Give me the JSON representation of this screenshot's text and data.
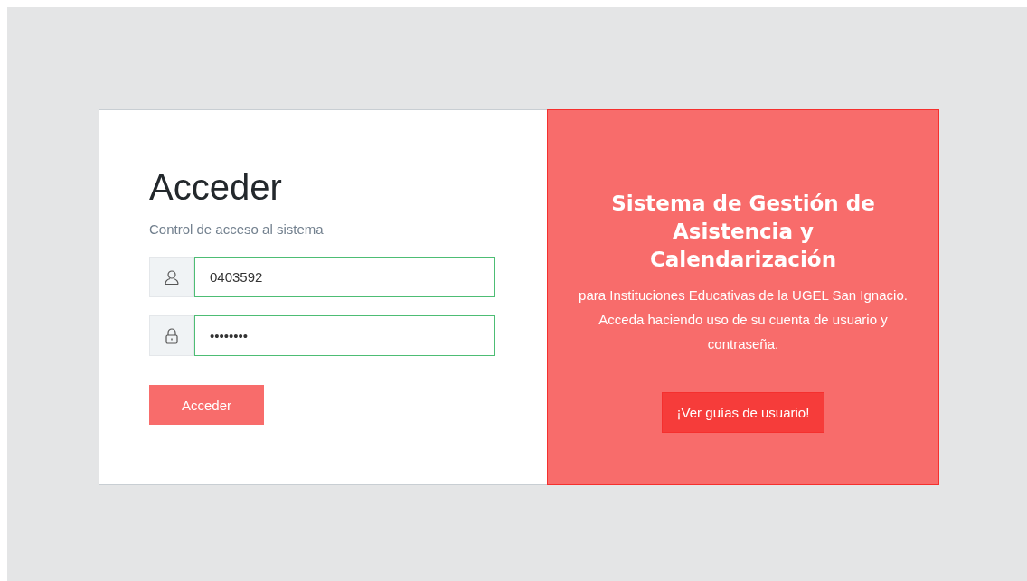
{
  "login": {
    "title": "Acceder",
    "subtitle": "Control de acceso al sistema",
    "fields": [
      {
        "kind": "user",
        "value": "0403592",
        "valid": true
      },
      {
        "kind": "password",
        "value": "••••••••",
        "valid": true
      }
    ],
    "button": "Acceder"
  },
  "info": {
    "title": "Sistema de Gestión de Asistencia y Calendarización",
    "text": "para Instituciones Educativas de la UGEL San Ignacio. Acceda haciendo uso de su cuenta de usuario y contraseña.",
    "button": "¡Ver guías de usuario!"
  }
}
